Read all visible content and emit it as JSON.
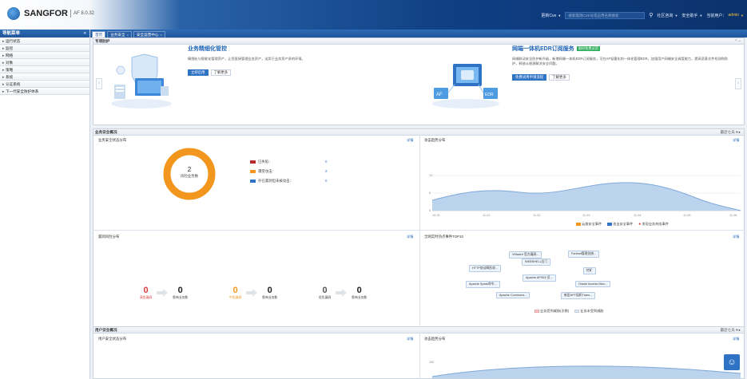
{
  "header": {
    "brand": "SANGFOR",
    "version": "AF 8.0.32",
    "selector_label": "更新Cve",
    "search_placeholder": "搜索漏洞CVE号或应用名称搜索",
    "menu_community": "社区咨询",
    "menu_security": "安全助手",
    "user_label": "当前用户：",
    "user_name": "admin"
  },
  "sidebar": {
    "title": "导航菜单",
    "items": [
      {
        "label": "运行状态"
      },
      {
        "label": "监控"
      },
      {
        "label": "网络"
      },
      {
        "label": "对象"
      },
      {
        "label": "策略"
      },
      {
        "label": "系统"
      },
      {
        "label": "认证系统"
      },
      {
        "label": "下一代安全防护体系"
      }
    ]
  },
  "tabs": [
    {
      "label": "首页",
      "active": true
    },
    {
      "label": "业务安全",
      "active": false
    },
    {
      "label": "安全运营中心",
      "active": false
    }
  ],
  "promo": {
    "title": "专项防护",
    "left": {
      "title": "业务精细化管控",
      "desc": "精细化与智能化管理资产，让您直接管理业务资产，适用于业务资产多的环境。",
      "btn_primary": "立即启用",
      "btn_secondary": "了解更多"
    },
    "right": {
      "title": "网端一体机EDR订阅服务",
      "badge": "限时免费试用",
      "desc": "网端联动安全防护新升级，新增网端一体机EDR订阅服务，可在AF轻量化的一体化管理EDR，加强用户网端安全调度能力，提高恶意文件检测和防护，释放从根源解决安全问题。",
      "btn_primary": "免费试用申请流程",
      "btn_secondary": "了解更多"
    }
  },
  "business_section": {
    "title": "业务安全概况",
    "range": "最近七天",
    "status_title": "业务安全状态分布",
    "detail": "详情",
    "donut_value": "2",
    "donut_label": "风险业务数",
    "legend": [
      {
        "label": "已失陷：",
        "value": "0",
        "color": "#b82b2b"
      },
      {
        "label": "遭受攻击：",
        "value": "2",
        "color": "#f2961d"
      },
      {
        "label": "存在漏洞但未被攻击：",
        "value": "0",
        "color": "#2e73c4"
      }
    ],
    "trend_title": "攻击趋势分布",
    "trend_y_ticks": [
      "12",
      "6",
      "0"
    ],
    "trend_x_ticks": [
      "10-31",
      "11-01",
      "11-02",
      "11-03",
      "11-04",
      "11-05",
      "11-06"
    ],
    "trend_legend": [
      {
        "label": "云盾安全事件",
        "color": "#f2961d"
      },
      {
        "label": "攻击安全事件",
        "color": "#2e73c4"
      },
      {
        "label": "发现业务失陷事件",
        "color": "#d93a3a"
      }
    ],
    "vuln_title": "漏洞风险分布",
    "vuln_stats": [
      {
        "num": "0",
        "label": "高危漏洞",
        "color": "#d93a3a",
        "num2": "0",
        "label2": "影响业务数"
      },
      {
        "num": "0",
        "label": "中危漏洞",
        "color": "#f2961d",
        "num2": "0",
        "label2": "影响业务数"
      },
      {
        "num": "0",
        "label": "低危漏洞",
        "color": "#555555",
        "num2": "0",
        "label2": "影响业务数"
      }
    ],
    "hot_title": "全网实时热点事件TOP10",
    "hot_tags": [
      "VMware 官方漏洞...",
      "Fortinet管理员绕...",
      "WEBSHELL后门",
      "HTTP协议畸形攻...",
      "挖矿",
      "Apache APISIX 反...",
      "Apache Spark命令...",
      "Oracle Access Man...",
      "Apache Commons...",
      "新型APT组织Trans..."
    ],
    "hot_legend": [
      {
        "label": "业务受到威胁(次数)",
        "color": "#f5c9c9"
      },
      {
        "label": "业务未受到威胁",
        "color": "#dfe6ef"
      }
    ]
  },
  "user_section": {
    "title": "用户安全概况",
    "range": "最近七天",
    "status_title": "用户安全状态分布",
    "detail": "详情",
    "trend_title": "攻击趋势分布",
    "trend_y_tick": "150"
  }
}
